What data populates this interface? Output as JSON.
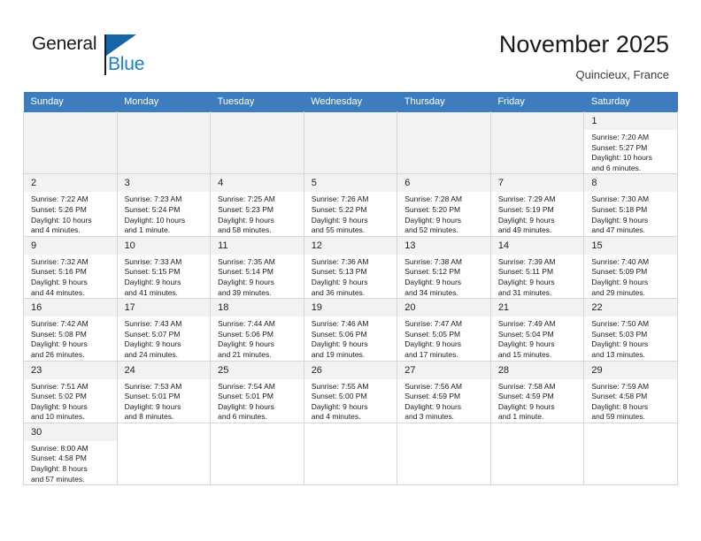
{
  "brand": {
    "name_top": "General",
    "name_bottom": "Blue",
    "color_dark": "#1a1a1a",
    "color_blue": "#1b7fc4"
  },
  "header": {
    "title": "November 2025",
    "subtitle": "Quincieux, France"
  },
  "theme": {
    "header_row_bg": "#3d7cbf",
    "daynum_bg": "#f2f2f2",
    "grid_line": "#d6d6d6",
    "empty_cell_bg": "#f2f2f2"
  },
  "calendar": {
    "weekday_headers": [
      "Sunday",
      "Monday",
      "Tuesday",
      "Wednesday",
      "Thursday",
      "Friday",
      "Saturday"
    ],
    "labels": {
      "sunrise": "Sunrise:",
      "sunset": "Sunset:",
      "daylight": "Daylight:"
    },
    "weeks": [
      [
        {
          "empty": true
        },
        {
          "empty": true
        },
        {
          "empty": true
        },
        {
          "empty": true
        },
        {
          "empty": true
        },
        {
          "empty": true
        },
        {
          "day": "1",
          "sunrise": "Sunrise: 7:20 AM",
          "sunset": "Sunset: 5:27 PM",
          "daylight_1": "Daylight: 10 hours",
          "daylight_2": "and 6 minutes."
        }
      ],
      [
        {
          "day": "2",
          "sunrise": "Sunrise: 7:22 AM",
          "sunset": "Sunset: 5:26 PM",
          "daylight_1": "Daylight: 10 hours",
          "daylight_2": "and 4 minutes."
        },
        {
          "day": "3",
          "sunrise": "Sunrise: 7:23 AM",
          "sunset": "Sunset: 5:24 PM",
          "daylight_1": "Daylight: 10 hours",
          "daylight_2": "and 1 minute."
        },
        {
          "day": "4",
          "sunrise": "Sunrise: 7:25 AM",
          "sunset": "Sunset: 5:23 PM",
          "daylight_1": "Daylight: 9 hours",
          "daylight_2": "and 58 minutes."
        },
        {
          "day": "5",
          "sunrise": "Sunrise: 7:26 AM",
          "sunset": "Sunset: 5:22 PM",
          "daylight_1": "Daylight: 9 hours",
          "daylight_2": "and 55 minutes."
        },
        {
          "day": "6",
          "sunrise": "Sunrise: 7:28 AM",
          "sunset": "Sunset: 5:20 PM",
          "daylight_1": "Daylight: 9 hours",
          "daylight_2": "and 52 minutes."
        },
        {
          "day": "7",
          "sunrise": "Sunrise: 7:29 AM",
          "sunset": "Sunset: 5:19 PM",
          "daylight_1": "Daylight: 9 hours",
          "daylight_2": "and 49 minutes."
        },
        {
          "day": "8",
          "sunrise": "Sunrise: 7:30 AM",
          "sunset": "Sunset: 5:18 PM",
          "daylight_1": "Daylight: 9 hours",
          "daylight_2": "and 47 minutes."
        }
      ],
      [
        {
          "day": "9",
          "sunrise": "Sunrise: 7:32 AM",
          "sunset": "Sunset: 5:16 PM",
          "daylight_1": "Daylight: 9 hours",
          "daylight_2": "and 44 minutes."
        },
        {
          "day": "10",
          "sunrise": "Sunrise: 7:33 AM",
          "sunset": "Sunset: 5:15 PM",
          "daylight_1": "Daylight: 9 hours",
          "daylight_2": "and 41 minutes."
        },
        {
          "day": "11",
          "sunrise": "Sunrise: 7:35 AM",
          "sunset": "Sunset: 5:14 PM",
          "daylight_1": "Daylight: 9 hours",
          "daylight_2": "and 39 minutes."
        },
        {
          "day": "12",
          "sunrise": "Sunrise: 7:36 AM",
          "sunset": "Sunset: 5:13 PM",
          "daylight_1": "Daylight: 9 hours",
          "daylight_2": "and 36 minutes."
        },
        {
          "day": "13",
          "sunrise": "Sunrise: 7:38 AM",
          "sunset": "Sunset: 5:12 PM",
          "daylight_1": "Daylight: 9 hours",
          "daylight_2": "and 34 minutes."
        },
        {
          "day": "14",
          "sunrise": "Sunrise: 7:39 AM",
          "sunset": "Sunset: 5:11 PM",
          "daylight_1": "Daylight: 9 hours",
          "daylight_2": "and 31 minutes."
        },
        {
          "day": "15",
          "sunrise": "Sunrise: 7:40 AM",
          "sunset": "Sunset: 5:09 PM",
          "daylight_1": "Daylight: 9 hours",
          "daylight_2": "and 29 minutes."
        }
      ],
      [
        {
          "day": "16",
          "sunrise": "Sunrise: 7:42 AM",
          "sunset": "Sunset: 5:08 PM",
          "daylight_1": "Daylight: 9 hours",
          "daylight_2": "and 26 minutes."
        },
        {
          "day": "17",
          "sunrise": "Sunrise: 7:43 AM",
          "sunset": "Sunset: 5:07 PM",
          "daylight_1": "Daylight: 9 hours",
          "daylight_2": "and 24 minutes."
        },
        {
          "day": "18",
          "sunrise": "Sunrise: 7:44 AM",
          "sunset": "Sunset: 5:06 PM",
          "daylight_1": "Daylight: 9 hours",
          "daylight_2": "and 21 minutes."
        },
        {
          "day": "19",
          "sunrise": "Sunrise: 7:46 AM",
          "sunset": "Sunset: 5:06 PM",
          "daylight_1": "Daylight: 9 hours",
          "daylight_2": "and 19 minutes."
        },
        {
          "day": "20",
          "sunrise": "Sunrise: 7:47 AM",
          "sunset": "Sunset: 5:05 PM",
          "daylight_1": "Daylight: 9 hours",
          "daylight_2": "and 17 minutes."
        },
        {
          "day": "21",
          "sunrise": "Sunrise: 7:49 AM",
          "sunset": "Sunset: 5:04 PM",
          "daylight_1": "Daylight: 9 hours",
          "daylight_2": "and 15 minutes."
        },
        {
          "day": "22",
          "sunrise": "Sunrise: 7:50 AM",
          "sunset": "Sunset: 5:03 PM",
          "daylight_1": "Daylight: 9 hours",
          "daylight_2": "and 13 minutes."
        }
      ],
      [
        {
          "day": "23",
          "sunrise": "Sunrise: 7:51 AM",
          "sunset": "Sunset: 5:02 PM",
          "daylight_1": "Daylight: 9 hours",
          "daylight_2": "and 10 minutes."
        },
        {
          "day": "24",
          "sunrise": "Sunrise: 7:53 AM",
          "sunset": "Sunset: 5:01 PM",
          "daylight_1": "Daylight: 9 hours",
          "daylight_2": "and 8 minutes."
        },
        {
          "day": "25",
          "sunrise": "Sunrise: 7:54 AM",
          "sunset": "Sunset: 5:01 PM",
          "daylight_1": "Daylight: 9 hours",
          "daylight_2": "and 6 minutes."
        },
        {
          "day": "26",
          "sunrise": "Sunrise: 7:55 AM",
          "sunset": "Sunset: 5:00 PM",
          "daylight_1": "Daylight: 9 hours",
          "daylight_2": "and 4 minutes."
        },
        {
          "day": "27",
          "sunrise": "Sunrise: 7:56 AM",
          "sunset": "Sunset: 4:59 PM",
          "daylight_1": "Daylight: 9 hours",
          "daylight_2": "and 3 minutes."
        },
        {
          "day": "28",
          "sunrise": "Sunrise: 7:58 AM",
          "sunset": "Sunset: 4:59 PM",
          "daylight_1": "Daylight: 9 hours",
          "daylight_2": "and 1 minute."
        },
        {
          "day": "29",
          "sunrise": "Sunrise: 7:59 AM",
          "sunset": "Sunset: 4:58 PM",
          "daylight_1": "Daylight: 8 hours",
          "daylight_2": "and 59 minutes."
        }
      ],
      [
        {
          "day": "30",
          "sunrise": "Sunrise: 8:00 AM",
          "sunset": "Sunset: 4:58 PM",
          "daylight_1": "Daylight: 8 hours",
          "daylight_2": "and 57 minutes."
        },
        {
          "blank": true
        },
        {
          "blank": true
        },
        {
          "blank": true
        },
        {
          "blank": true
        },
        {
          "blank": true
        },
        {
          "blank": true
        }
      ]
    ]
  }
}
